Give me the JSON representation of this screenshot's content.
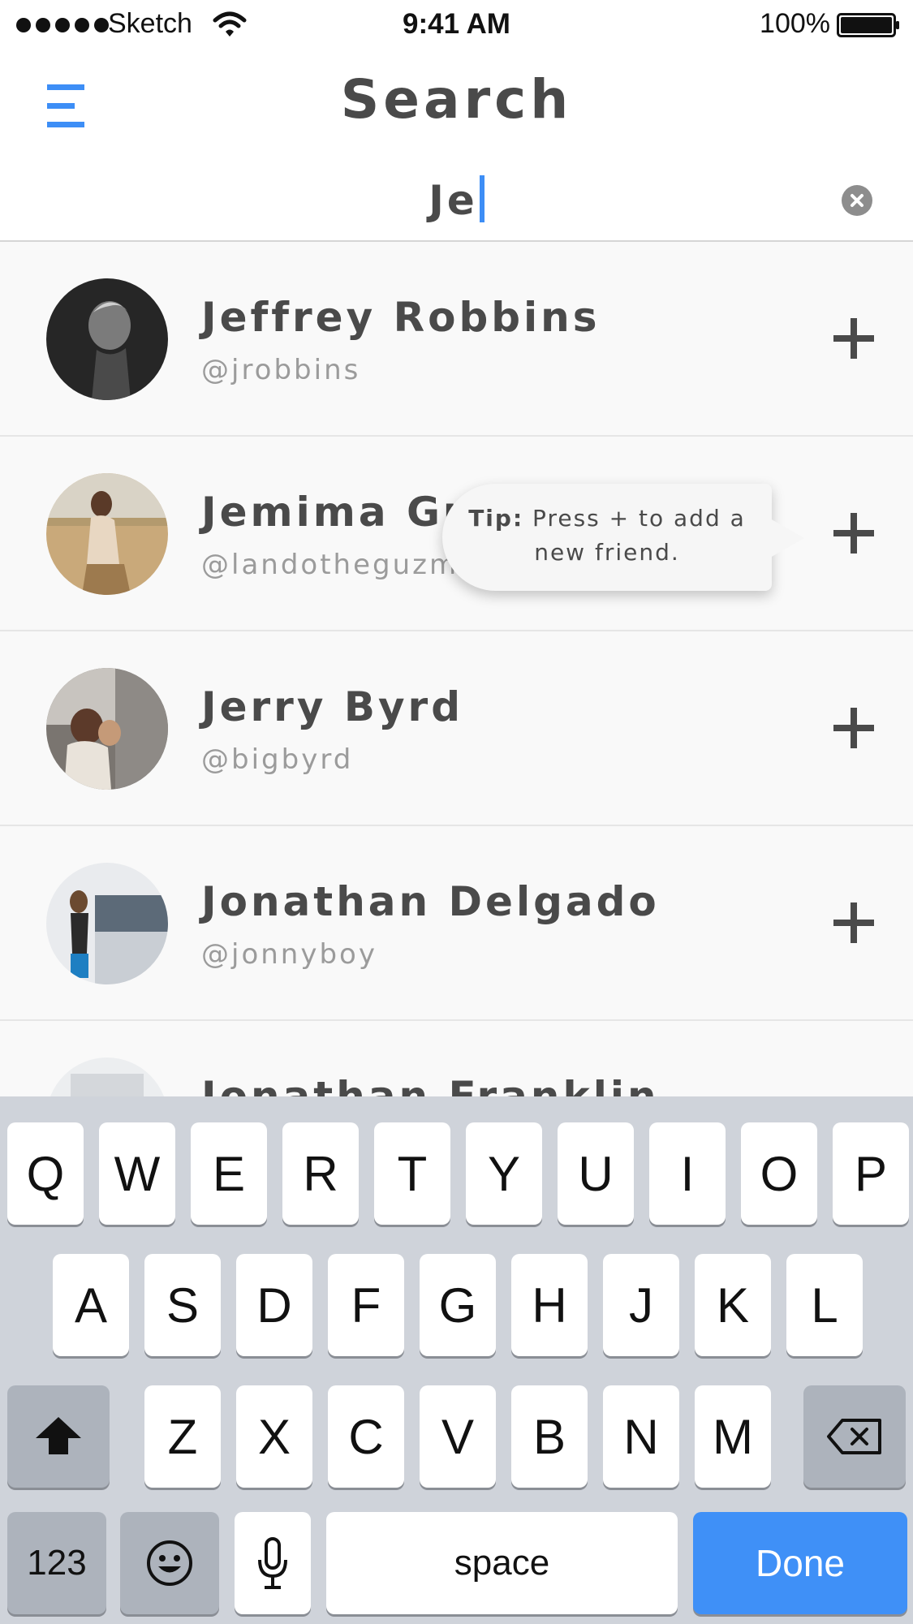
{
  "status_bar": {
    "carrier": "Sketch",
    "time": "9:41 AM",
    "battery": "100%"
  },
  "header": {
    "title": "Search",
    "menu_icon": "hamburger-menu-icon"
  },
  "search": {
    "value": "Je",
    "clear_icon": "clear-circle-icon"
  },
  "results": [
    {
      "name": "Jeffrey Robbins",
      "handle": "@jrobbins"
    },
    {
      "name": "Jemima Gu",
      "handle": "@landotheguzma"
    },
    {
      "name": "Jerry Byrd",
      "handle": "@bigbyrd"
    },
    {
      "name": "Jonathan Delgado",
      "handle": "@jonnyboy"
    },
    {
      "name": "Jonathan Franklin",
      "handle": ""
    }
  ],
  "tooltip": {
    "tip": "Tip:",
    "line1": "Press + to add a",
    "line2": "new friend."
  },
  "keyboard": {
    "row1": [
      "Q",
      "W",
      "E",
      "R",
      "T",
      "Y",
      "U",
      "I",
      "O",
      "P"
    ],
    "row2": [
      "A",
      "S",
      "D",
      "F",
      "G",
      "H",
      "J",
      "K",
      "L"
    ],
    "row3": [
      "Z",
      "X",
      "C",
      "V",
      "B",
      "N",
      "M"
    ],
    "numbers": "123",
    "space": "space",
    "done": "Done"
  },
  "colors": {
    "accent": "#3d8ef6",
    "text": "#4a4a4a",
    "subtext": "#9b9b9b",
    "keyboard_bg": "#cfd3da"
  }
}
